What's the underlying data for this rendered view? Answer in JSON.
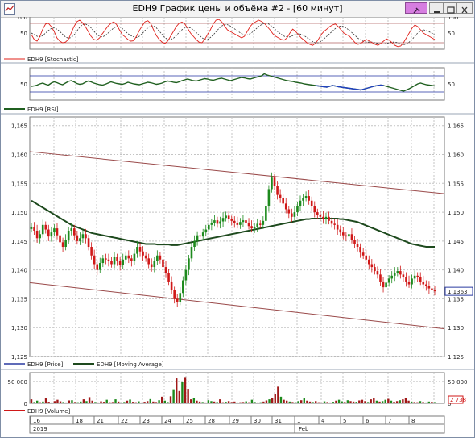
{
  "window": {
    "title": "EDH9 График цены и объёма #2 - [60 минут]"
  },
  "chart_data": [
    {
      "type": "line",
      "name": "stochastic",
      "legend": "EDH9 [Stochastic]",
      "ylim": [
        0,
        100
      ],
      "ticks": [
        "100",
        "50"
      ],
      "tick_values": [
        100,
        50
      ],
      "levels": [
        80,
        20
      ],
      "colors": {
        "k": "#e0201a",
        "d": "#333333",
        "level": "#b06060"
      },
      "k_values": [
        45,
        30,
        25,
        40,
        62,
        78,
        80,
        70,
        55,
        35,
        25,
        20,
        22,
        30,
        50,
        70,
        85,
        90,
        82,
        70,
        55,
        40,
        30,
        28,
        35,
        48,
        60,
        72,
        80,
        85,
        76,
        60,
        45,
        38,
        30,
        25,
        26,
        40,
        58,
        72,
        85,
        88,
        80,
        60,
        42,
        30,
        22,
        18,
        25,
        40,
        55,
        70,
        80,
        84,
        78,
        65,
        50,
        40,
        30,
        22,
        20,
        30,
        45,
        60,
        78,
        90,
        92,
        85,
        72,
        60,
        55,
        50,
        45,
        40,
        35,
        40,
        55,
        70,
        80,
        85,
        90,
        86,
        80,
        70,
        60,
        48,
        40,
        35,
        30,
        28,
        35,
        50,
        62,
        55,
        45,
        35,
        28,
        20,
        15,
        12,
        18,
        30,
        45,
        55,
        62,
        70,
        75,
        78,
        70,
        60,
        50,
        45,
        40,
        30,
        20,
        15,
        18,
        25,
        30,
        25,
        20,
        15,
        12,
        18,
        25,
        32,
        28,
        20,
        12,
        8,
        10,
        20,
        35,
        50,
        65,
        75,
        70,
        60,
        50,
        45,
        40,
        35,
        30
      ],
      "d_values": [
        50,
        45,
        40,
        38,
        42,
        50,
        58,
        64,
        66,
        62,
        55,
        46,
        38,
        34,
        36,
        44,
        56,
        68,
        76,
        78,
        74,
        66,
        56,
        46,
        40,
        38,
        42,
        50,
        58,
        66,
        70,
        70,
        64,
        56,
        48,
        42,
        38,
        36,
        40,
        48,
        58,
        66,
        72,
        72,
        66,
        56,
        46,
        36,
        30,
        30,
        34,
        42,
        52,
        60,
        66,
        68,
        66,
        60,
        52,
        44,
        36,
        30,
        30,
        36,
        44,
        54,
        64,
        72,
        76,
        76,
        72,
        66,
        60,
        54,
        48,
        44,
        44,
        48,
        54,
        62,
        70,
        76,
        80,
        80,
        76,
        68,
        60,
        52,
        46,
        40,
        38,
        38,
        42,
        46,
        48,
        46,
        42,
        36,
        30,
        24,
        20,
        20,
        24,
        32,
        40,
        48,
        56,
        64,
        70,
        72,
        70,
        64,
        58,
        50,
        42,
        34,
        28,
        24,
        22,
        22,
        22,
        20,
        18,
        16,
        16,
        18,
        20,
        22,
        22,
        20,
        16,
        14,
        16,
        22,
        30,
        40,
        50,
        56,
        60,
        58,
        54,
        50,
        44
      ]
    },
    {
      "type": "line",
      "name": "rsi",
      "legend": "EDH9 [RSI]",
      "ylim": [
        10,
        90
      ],
      "ticks": [
        "50"
      ],
      "tick_values": [
        50
      ],
      "levels": [
        70,
        30
      ],
      "colors": {
        "line": "#206020",
        "highlight": "#2040c0",
        "level": "#2030a0"
      },
      "values": [
        44,
        45,
        47,
        50,
        52,
        49,
        47,
        52,
        55,
        53,
        50,
        48,
        52,
        56,
        58,
        55,
        51,
        49,
        50,
        54,
        57,
        55,
        52,
        50,
        48,
        47,
        49,
        52,
        55,
        53,
        51,
        50,
        49,
        51,
        54,
        52,
        50,
        49,
        48,
        50,
        52,
        54,
        53,
        51,
        49,
        50,
        52,
        55,
        57,
        56,
        54,
        53,
        55,
        58,
        60,
        62,
        60,
        58,
        57,
        59,
        61,
        63,
        62,
        60,
        59,
        61,
        63,
        64,
        62,
        60,
        58,
        60,
        62,
        64,
        66,
        65,
        63,
        62,
        64,
        66,
        68,
        70,
        75,
        72,
        70,
        68,
        66,
        64,
        62,
        60,
        58,
        57,
        56,
        54,
        53,
        52,
        50,
        49,
        48,
        47,
        46,
        45,
        44,
        43,
        42,
        44,
        46,
        45,
        43,
        42,
        41,
        40,
        39,
        38,
        37,
        36,
        35,
        37,
        39,
        41,
        43,
        45,
        46,
        47,
        46,
        44,
        42,
        40,
        38,
        36,
        34,
        32,
        35,
        38,
        42,
        46,
        50,
        52,
        50,
        48,
        47,
        46,
        45
      ],
      "highlight_start": 100
    },
    {
      "type": "candlestick",
      "name": "price",
      "legend_price": "EDH9 [Price]",
      "legend_ma": "EDH9 [Moving Average]",
      "ylim": [
        1.125,
        1.1665
      ],
      "ticks": [
        "1,165",
        "1,160",
        "1,155",
        "1,150",
        "1,145",
        "1,140",
        "1,135",
        "1,130",
        "1,125"
      ],
      "tick_values": [
        1.165,
        1.16,
        1.155,
        1.15,
        1.145,
        1.14,
        1.135,
        1.13,
        1.125
      ],
      "last_price": "1,1363",
      "last_price_value": 1.1363,
      "colors": {
        "up": "#1d8a1d",
        "down": "#d01818",
        "ma": "#1e4a1e",
        "channel": "#9a4a4a",
        "grid": "#b8b8b8"
      },
      "closes": [
        1.1475,
        1.1468,
        1.1455,
        1.1462,
        1.1478,
        1.147,
        1.1458,
        1.1465,
        1.1472,
        1.146,
        1.1448,
        1.144,
        1.1452,
        1.1468,
        1.1472,
        1.146,
        1.145,
        1.1455,
        1.1462,
        1.1455,
        1.144,
        1.1425,
        1.141,
        1.14,
        1.1412,
        1.142,
        1.1418,
        1.1415,
        1.141,
        1.1422,
        1.1415,
        1.1408,
        1.1418,
        1.1425,
        1.142,
        1.1415,
        1.1428,
        1.144,
        1.1432,
        1.1425,
        1.142,
        1.141,
        1.1405,
        1.1415,
        1.1425,
        1.1418,
        1.1405,
        1.1395,
        1.138,
        1.1365,
        1.135,
        1.1345,
        1.136,
        1.1382,
        1.14,
        1.142,
        1.144,
        1.145,
        1.146,
        1.1458,
        1.1465,
        1.147,
        1.1478,
        1.1482,
        1.1486,
        1.148,
        1.1484,
        1.149,
        1.1494,
        1.1488,
        1.1485,
        1.1482,
        1.1478,
        1.1483,
        1.1486,
        1.1482,
        1.1476,
        1.1472,
        1.1475,
        1.148,
        1.1478,
        1.1485,
        1.151,
        1.154,
        1.156,
        1.1545,
        1.153,
        1.1525,
        1.1515,
        1.1505,
        1.1498,
        1.1492,
        1.15,
        1.151,
        1.152,
        1.1525,
        1.1528,
        1.152,
        1.151,
        1.15,
        1.1495,
        1.1492,
        1.1488,
        1.1492,
        1.1485,
        1.148,
        1.1478,
        1.147,
        1.1465,
        1.146,
        1.1458,
        1.1462,
        1.1452,
        1.1445,
        1.144,
        1.143,
        1.1425,
        1.1418,
        1.141,
        1.1405,
        1.1398,
        1.1392,
        1.138,
        1.137,
        1.1378,
        1.1385,
        1.139,
        1.1395,
        1.1398,
        1.1392,
        1.1388,
        1.138,
        1.1375,
        1.1385,
        1.139,
        1.1388,
        1.138,
        1.1375,
        1.1372,
        1.1368,
        1.1365,
        1.1363
      ],
      "ma": [
        1.152,
        1.1517,
        1.1514,
        1.1511,
        1.1508,
        1.1505,
        1.1502,
        1.1499,
        1.1496,
        1.1493,
        1.149,
        1.1487,
        1.1484,
        1.1481,
        1.1478,
        1.1476,
        1.1474,
        1.1472,
        1.147,
        1.1468,
        1.1466,
        1.1464,
        1.1463,
        1.1462,
        1.1461,
        1.146,
        1.1459,
        1.1458,
        1.1457,
        1.1456,
        1.1455,
        1.1454,
        1.1453,
        1.1452,
        1.1451,
        1.145,
        1.1449,
        1.1448,
        1.1447,
        1.1446,
        1.1445,
        1.1445,
        1.1445,
        1.1445,
        1.1444,
        1.1444,
        1.1444,
        1.1444,
        1.1444,
        1.1443,
        1.1443,
        1.1443,
        1.1444,
        1.1445,
        1.1446,
        1.1447,
        1.1448,
        1.1449,
        1.145,
        1.1451,
        1.1452,
        1.1453,
        1.1454,
        1.1455,
        1.1456,
        1.1457,
        1.1458,
        1.1459,
        1.146,
        1.1461,
        1.1462,
        1.1463,
        1.1464,
        1.1465,
        1.1466,
        1.1467,
        1.1468,
        1.1469,
        1.147,
        1.1471,
        1.1472,
        1.1473,
        1.1474,
        1.1475,
        1.1476,
        1.1477,
        1.1478,
        1.1479,
        1.148,
        1.1481,
        1.1482,
        1.1483,
        1.1484,
        1.1485,
        1.1486,
        1.1487,
        1.1488,
        1.1488,
        1.1489,
        1.1489,
        1.1489,
        1.1489,
        1.1489,
        1.1489,
        1.1489,
        1.1489,
        1.1489,
        1.1489,
        1.1488,
        1.1488,
        1.1487,
        1.1486,
        1.1485,
        1.1484,
        1.1483,
        1.1481,
        1.1479,
        1.1477,
        1.1475,
        1.1473,
        1.1471,
        1.1469,
        1.1467,
        1.1465,
        1.1463,
        1.1461,
        1.1459,
        1.1457,
        1.1455,
        1.1453,
        1.1451,
        1.1449,
        1.1447,
        1.1445,
        1.1444,
        1.1443,
        1.1442,
        1.1441,
        1.144,
        1.144,
        1.144,
        1.144
      ],
      "channel_upper": [
        1.1605,
        1.1532
      ],
      "channel_lower": [
        1.1378,
        1.1298
      ]
    },
    {
      "type": "bar",
      "name": "volume",
      "legend": "EDH9 [Volume]",
      "ylim": [
        0,
        70000
      ],
      "ticks": [
        "50 000",
        "0"
      ],
      "tick_values": [
        50000,
        0
      ],
      "last_volume": "2 738",
      "colors": {
        "up": "#1d8a1d",
        "down": "#a01818"
      },
      "values": [
        9000,
        3000,
        6000,
        2500,
        4000,
        11000,
        3500,
        2000,
        5000,
        8000,
        4500,
        3000,
        2000,
        6500,
        7000,
        3000,
        2500,
        4000,
        9000,
        5000,
        14000,
        6000,
        3000,
        2000,
        4500,
        3500,
        8000,
        2500,
        3000,
        9000,
        4000,
        2000,
        3000,
        6000,
        8500,
        3500,
        2500,
        4500,
        2000,
        3500,
        5000,
        9500,
        4000,
        3000,
        7000,
        15000,
        6000,
        3000,
        16000,
        32000,
        57000,
        28000,
        48000,
        60000,
        33000,
        9000,
        12000,
        6000,
        4000,
        3000,
        2000,
        7000,
        5000,
        4000,
        3000,
        9000,
        2500,
        3500,
        5000,
        3000,
        4000,
        2000,
        2500,
        3000,
        4500,
        2500,
        8000,
        3000,
        2000,
        2500,
        4000,
        6500,
        9000,
        12000,
        22000,
        38000,
        15000,
        8000,
        6000,
        4000,
        3000,
        2500,
        5000,
        7000,
        11000,
        6000,
        4000,
        3000,
        5000,
        2500,
        2000,
        4500,
        3000,
        2000,
        3500,
        6000,
        8000,
        4500,
        3000,
        7000,
        5000,
        4000,
        3500,
        6500,
        8000,
        5000,
        3000,
        9000,
        12000,
        6000,
        4000,
        5000,
        8000,
        10000,
        6000,
        3500,
        5000,
        7000,
        9000,
        12000,
        6000,
        4000,
        3000,
        2500,
        5000,
        3000,
        2000,
        4000,
        3500,
        2738
      ]
    }
  ],
  "time_axis": {
    "days": [
      "16",
      "18",
      "21",
      "22",
      "23",
      "24",
      "25",
      "28",
      "29",
      "30",
      "31",
      "1",
      "4",
      "5",
      "6",
      "7",
      "8"
    ],
    "day_positions": [
      40,
      93,
      119,
      149,
      176,
      203,
      230,
      257,
      287,
      314,
      340,
      368,
      398,
      425,
      453,
      481,
      510
    ],
    "year_label": "2019",
    "month_label": "Feb"
  }
}
